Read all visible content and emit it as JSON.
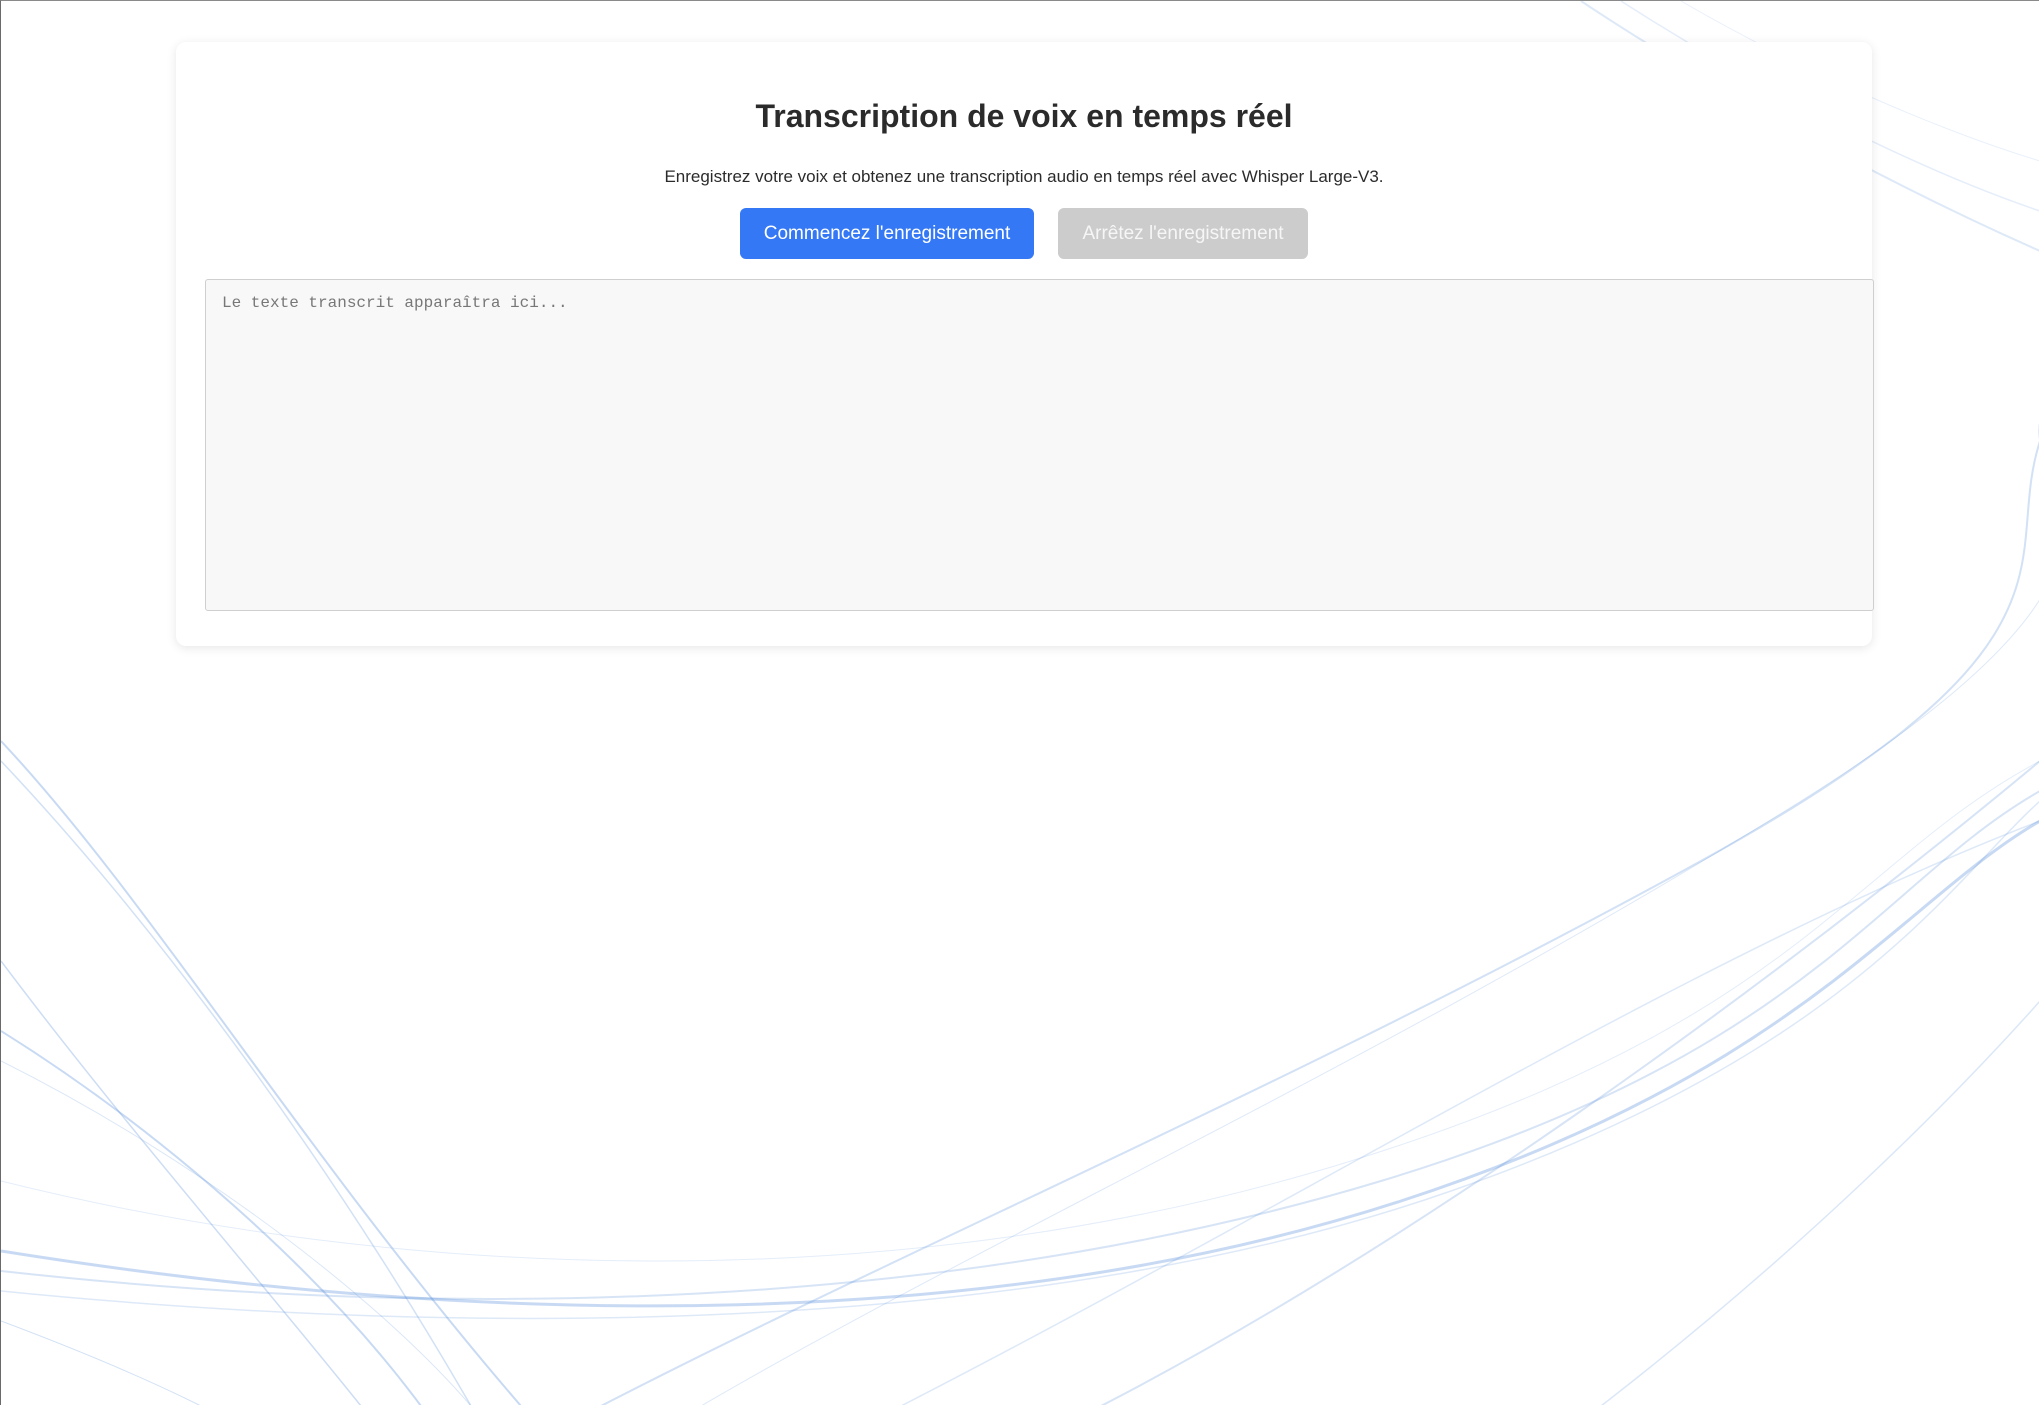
{
  "page": {
    "title": "Transcription de voix en temps réel",
    "subtitle": "Enregistrez votre voix et obtenez une transcription audio en temps réel avec Whisper Large-V3."
  },
  "controls": {
    "start_label": "Commencez l'enregistrement",
    "stop_label": "Arrêtez l'enregistrement",
    "stop_disabled": true
  },
  "transcript": {
    "value": "",
    "placeholder": "Le texte transcrit apparaîtra ici..."
  },
  "colors": {
    "accent": "#3478f6",
    "disabled": "#cccccc",
    "wave": "#4a86d8"
  }
}
